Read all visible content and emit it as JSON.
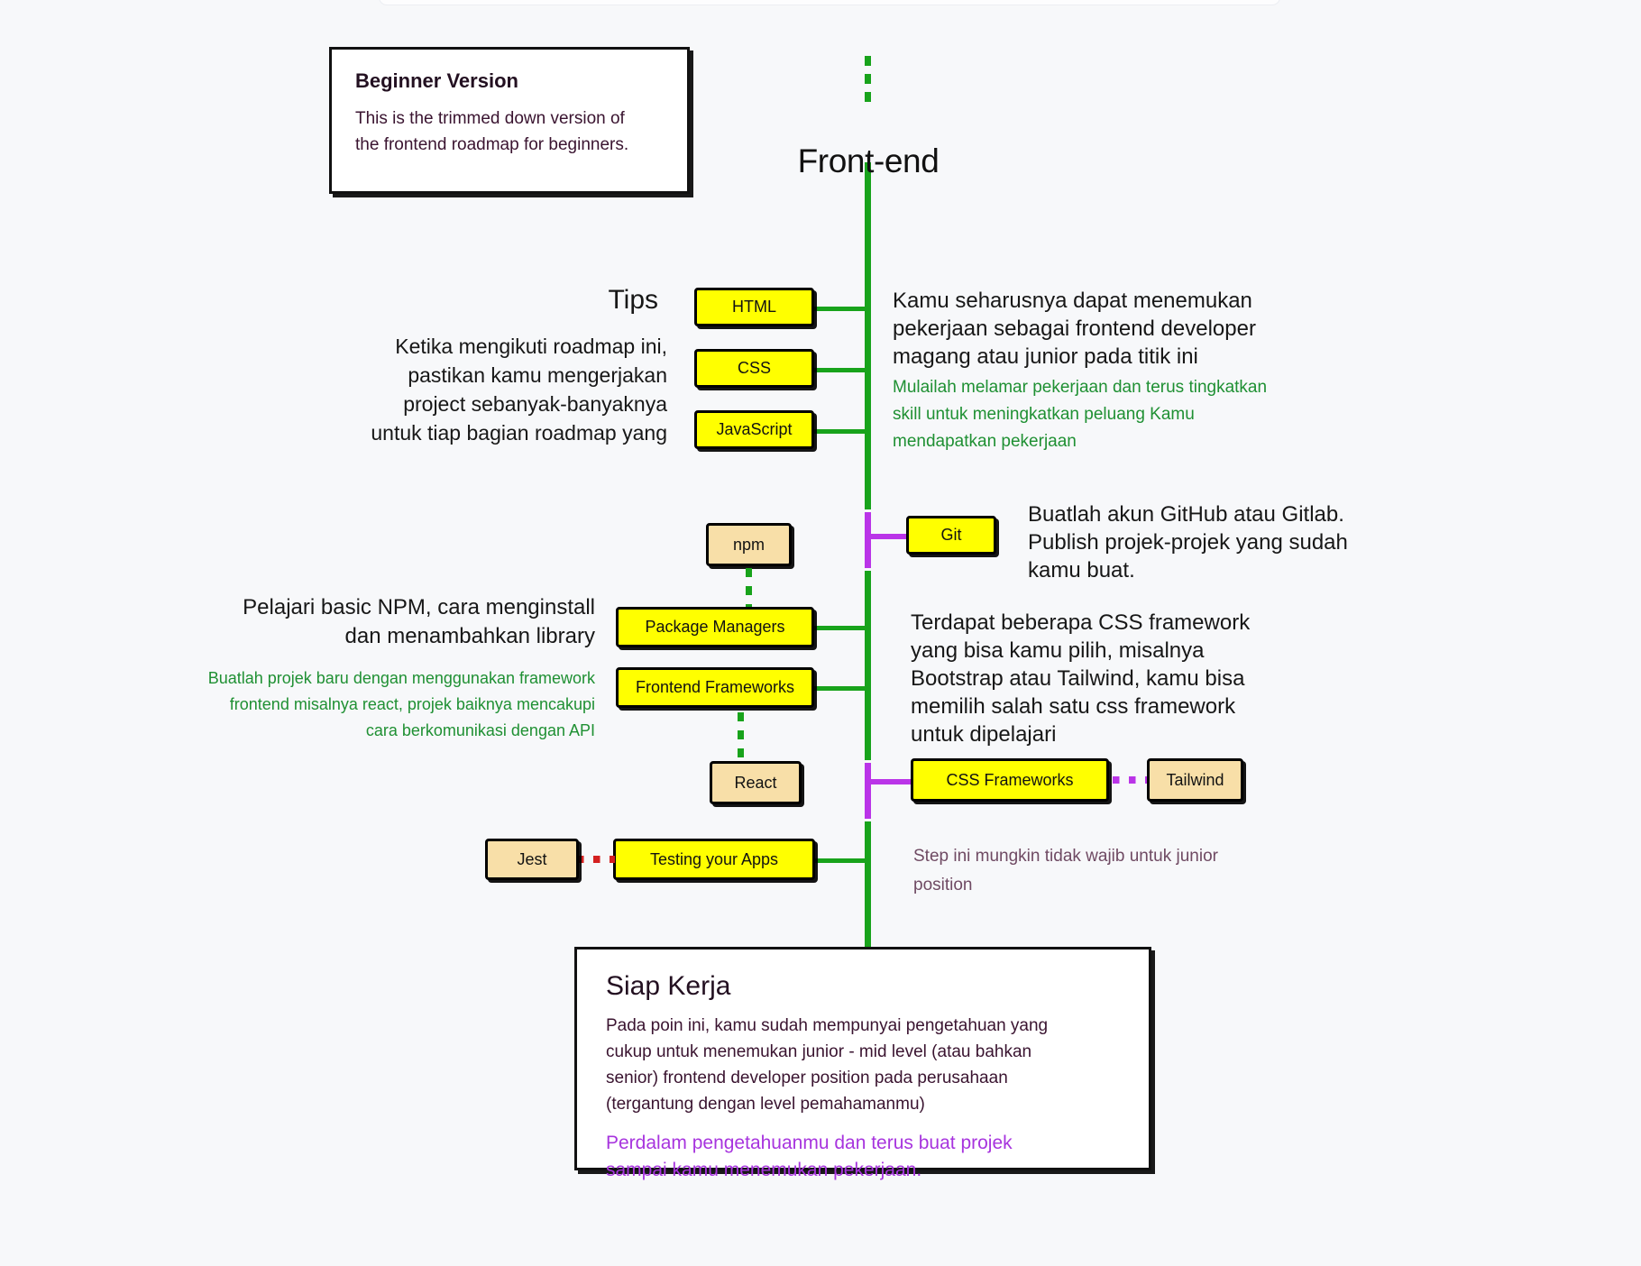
{
  "meta": {
    "title": "Front-end"
  },
  "beginner_box": {
    "heading": "Beginner Version",
    "line1": "This is the trimmed down version of",
    "line2": "the frontend roadmap for beginners."
  },
  "tips": {
    "heading": "Tips",
    "line1": "Ketika mengikuti roadmap ini,",
    "line2": "pastikan kamu mengerjakan",
    "line3": "project sebanyak-banyaknya",
    "line4": "untuk tiap bagian roadmap yang"
  },
  "nodes": {
    "html": "HTML",
    "css": "CSS",
    "javascript": "JavaScript",
    "npm": "npm",
    "git": "Git",
    "package_managers": "Package Managers",
    "frontend_frameworks": "Frontend Frameworks",
    "react": "React",
    "css_frameworks": "CSS Frameworks",
    "tailwind": "Tailwind",
    "jest": "Jest",
    "testing": "Testing your Apps"
  },
  "notes": {
    "job_main_l1": "Kamu seharusnya dapat menemukan",
    "job_main_l2": "pekerjaan sebagai frontend developer",
    "job_main_l3": "magang atau junior pada titik ini",
    "job_sub_l1": "Mulailah melamar pekerjaan dan terus tingkatkan",
    "job_sub_l2": "skill untuk meningkatkan peluang Kamu",
    "job_sub_l3": "mendapatkan pekerjaan",
    "git_l1": "Buatlah akun GitHub atau Gitlab.",
    "git_l2": "Publish projek-projek yang sudah",
    "git_l3": "kamu buat.",
    "npm_l1": "Pelajari basic NPM, cara menginstall",
    "npm_l2": "dan menambahkan library",
    "npm_sub_l1": "Buatlah projek baru dengan menggunakan framework",
    "npm_sub_l2": "frontend misalnya react, projek baiknya mencakupi",
    "npm_sub_l3": "cara berkomunikasi dengan API",
    "cssfw_l1": "Terdapat beberapa CSS framework",
    "cssfw_l2": "yang bisa kamu pilih, misalnya",
    "cssfw_l3": "Bootstrap atau Tailwind, kamu bisa",
    "cssfw_l4": "memilih salah satu css framework",
    "cssfw_l5": "untuk dipelajari",
    "testing_l1": "Step ini mungkin tidak wajib untuk junior",
    "testing_l2": "position"
  },
  "siap_kerja": {
    "heading": "Siap Kerja",
    "body_l1": "Pada poin ini, kamu sudah mempunyai pengetahuan yang",
    "body_l2": "cukup untuk menemukan junior - mid level (atau bahkan",
    "body_l3": "senior) frontend developer position pada perusahaan",
    "body_l4": "(tergantung dengan level pemahamanmu)",
    "accent_l1": "Perdalam pengetahuanmu dan terus buat projek",
    "accent_l2": "sampai kamu menemukan pekerjaan."
  },
  "colors": {
    "spine_green": "#18a31b",
    "branch_purple": "#ba34e8",
    "node_primary": "#ffff00",
    "node_secondary": "#f8dfa8",
    "text_green": "#1f9033",
    "text_purple": "#a734de",
    "background": "#f7f8fa"
  }
}
